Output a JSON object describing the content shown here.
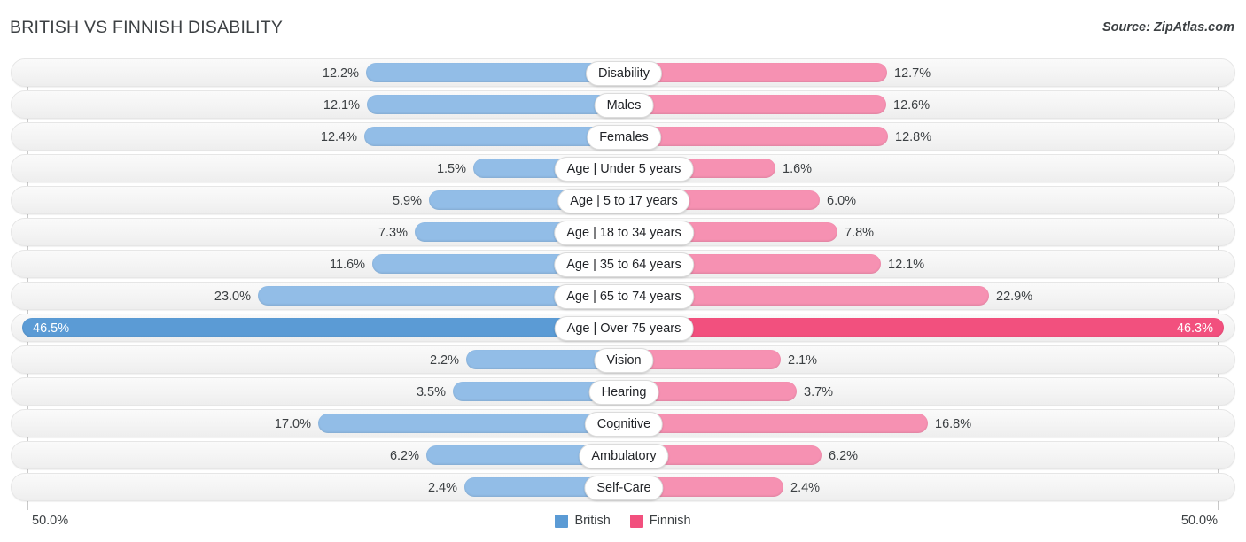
{
  "header": {
    "title": "BRITISH VS FINNISH DISABILITY",
    "source": "Source: ZipAtlas.com"
  },
  "axis": {
    "left_tick": "50.0%",
    "right_tick": "50.0%",
    "max_percent": 50.0
  },
  "legend": {
    "items": [
      {
        "label": "British",
        "color": "#5b9bd5",
        "icon": "square-swatch"
      },
      {
        "label": "Finnish",
        "color": "#f2507e",
        "icon": "square-swatch"
      }
    ]
  },
  "colors": {
    "british_light": "#92bde7",
    "british_strong": "#5b9bd5",
    "finnish_light": "#f691b2",
    "finnish_strong": "#f2507e",
    "row_background": "#f4f4f4",
    "text": "#3c4043"
  },
  "chart_data": {
    "type": "bar",
    "orientation": "diverging-horizontal",
    "title": "BRITISH VS FINNISH DISABILITY",
    "xlabel": "",
    "ylabel": "",
    "xlim": [
      -50.0,
      50.0
    ],
    "grid": false,
    "legend_position": "bottom-center",
    "categories": [
      "Disability",
      "Males",
      "Females",
      "Age | Under 5 years",
      "Age | 5 to 17 years",
      "Age | 18 to 34 years",
      "Age | 35 to 64 years",
      "Age | 65 to 74 years",
      "Age | Over 75 years",
      "Vision",
      "Hearing",
      "Cognitive",
      "Ambulatory",
      "Self-Care"
    ],
    "series": [
      {
        "name": "British",
        "side": "left",
        "values": [
          12.2,
          12.1,
          12.4,
          1.5,
          5.9,
          7.3,
          11.6,
          23.0,
          46.5,
          2.2,
          3.5,
          17.0,
          6.2,
          2.4
        ],
        "labels": [
          "12.2%",
          "12.1%",
          "12.4%",
          "1.5%",
          "5.9%",
          "7.3%",
          "11.6%",
          "23.0%",
          "46.5%",
          "2.2%",
          "3.5%",
          "17.0%",
          "6.2%",
          "2.4%"
        ]
      },
      {
        "name": "Finnish",
        "side": "right",
        "values": [
          12.7,
          12.6,
          12.8,
          1.6,
          6.0,
          7.8,
          12.1,
          22.9,
          46.3,
          2.1,
          3.7,
          16.8,
          6.2,
          2.4
        ],
        "labels": [
          "12.7%",
          "12.6%",
          "12.8%",
          "1.6%",
          "6.0%",
          "7.8%",
          "12.1%",
          "22.9%",
          "46.3%",
          "2.1%",
          "3.7%",
          "16.8%",
          "6.2%",
          "2.4%"
        ]
      }
    ]
  }
}
